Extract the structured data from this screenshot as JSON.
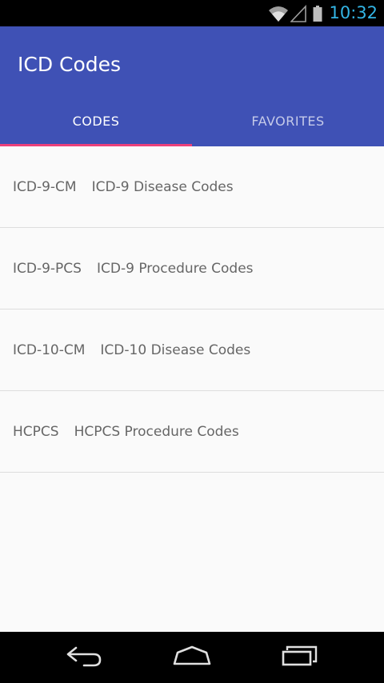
{
  "status_bar": {
    "time": "10:32",
    "icons": [
      "wifi-icon",
      "signal-icon",
      "battery-icon"
    ],
    "time_color": "#33b5e5"
  },
  "app_bar": {
    "title": "ICD Codes",
    "color": "#3f51b5"
  },
  "tabs": [
    {
      "label": "CODES",
      "active": true
    },
    {
      "label": "FAVORITES",
      "active": false
    }
  ],
  "tab_indicator_color": "#ec407a",
  "list": {
    "items": [
      {
        "code": "ICD-9-CM",
        "description": "ICD-9 Disease Codes"
      },
      {
        "code": "ICD-9-PCS",
        "description": "ICD-9 Procedure Codes"
      },
      {
        "code": "ICD-10-CM",
        "description": "ICD-10 Disease Codes"
      },
      {
        "code": "HCPCS",
        "description": "HCPCS Procedure Codes"
      }
    ]
  },
  "nav_bar": {
    "buttons": [
      "back-icon",
      "home-icon",
      "recent-apps-icon"
    ]
  }
}
